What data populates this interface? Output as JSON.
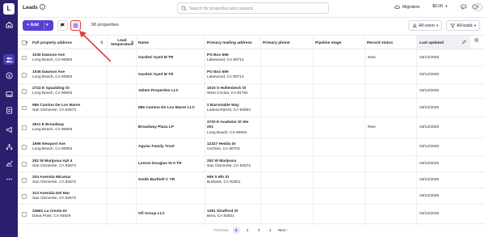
{
  "header": {
    "title": "Leads",
    "info": "i",
    "search_placeholder": "Search for properties and contacts",
    "migration_label": "Migration",
    "balance": "$0.00",
    "avatar_initial": "I"
  },
  "toolbar": {
    "add_label": "+ Add",
    "add_caret": "▾",
    "property_count": "96 properties",
    "all_users_label": "All users",
    "all_leads_label": "All leads"
  },
  "sidebar": {
    "logo": "L",
    "items": [
      "home-icon",
      "leads-icon",
      "dollar-icon",
      "inbox-icon",
      "list-icon",
      "campaign-icon",
      "org-icon",
      "analytics-icon",
      "more-icon"
    ]
  },
  "table": {
    "columns": [
      {
        "label": "Full property address"
      },
      {
        "label": "Lead temperature"
      },
      {
        "label": "Name"
      },
      {
        "label": "Primary mailing address"
      },
      {
        "label": "Primary phone"
      },
      {
        "label": "Pipeline stage"
      },
      {
        "label": "Record status"
      },
      {
        "label": "Last updated"
      }
    ],
    "rows": [
      {
        "addr1": "1040 Dawson Ave",
        "addr2": "Long Beach, CA 90804",
        "name": "Gardezi Syed M TR",
        "mail1": "PO Box 669",
        "mail2": "Lakewood, CA 90714",
        "mail3": "",
        "status": "New",
        "updated": "03/12/2025"
      },
      {
        "addr1": "1036 Dawson Ave",
        "addr2": "Long Beach, CA 90804",
        "name": "Gardezi Syed M TR",
        "mail1": "PO Box 669",
        "mail2": "Lakewood, CA 90714",
        "mail3": "",
        "status": "",
        "updated": "03/12/2025"
      },
      {
        "addr1": "2722 E Spaulding St",
        "addr2": "Long Beach, CA 90804",
        "name": "Aklem Properties LLC",
        "mail1": "1015 S Hollenbeck St",
        "mail2": "West Covina, CA 91791",
        "mail3": "",
        "status": "",
        "updated": "03/12/2025"
      },
      {
        "addr1": "686 Camino De Los Mares",
        "addr2": "San Clemente, CA 92673",
        "name": "686 Camino De Los Mares LLC",
        "mail1": "2 Barnstable Way",
        "mail2": "Ladera Ranch, CA 92694",
        "mail3": "",
        "status": "",
        "updated": "03/12/2025"
      },
      {
        "addr1": "2611 E Broadway",
        "addr2": "Long Beach, CA 90803",
        "name": "Broadway Plaza LP",
        "mail1": "3720 E Anaheim St Ste",
        "mail2": "201",
        "mail3": "Long Beach, CA 90804",
        "status": "New",
        "updated": "03/12/2025"
      },
      {
        "addr1": "1696 Newport Ave",
        "addr2": "Long Beach, CA 90804",
        "name": "Aguiar Family Trust",
        "mail1": "12327 Hedda Dr",
        "mail2": "Cerritos, CA 90703",
        "mail3": "",
        "status": "",
        "updated": "03/12/2025"
      },
      {
        "addr1": "252 W Mariposa Apt 4",
        "addr2": "San Clemente, CA 92672",
        "name": "Lemon Douglas W II TR",
        "mail1": "252 W Mariposa",
        "mail2": "San Clemente, CA 92672",
        "mail3": "",
        "status": "",
        "updated": "03/12/2025"
      },
      {
        "addr1": "204 Avenida Miramar",
        "addr2": "San Clemente, CA 92672",
        "name": "Smith Barthell C TR",
        "mail1": "909 S 6th St",
        "mail2": "Burbank, CA 91501",
        "mail3": "",
        "status": "",
        "updated": "03/12/2025"
      },
      {
        "addr1": "313 Avenida Del Mar",
        "addr2": "San Clemente, CA 92672",
        "name": "",
        "mail1": "",
        "mail2": "",
        "mail3": "",
        "status": "",
        "updated": "03/12/2025"
      },
      {
        "addr1": "24661 La Cresta Dr",
        "addr2": "Dana Point, CA 92629",
        "name": "Ofi Group LLC",
        "mail1": "1391 Stratford St",
        "mail2": "Brea, CA 92821",
        "mail3": "",
        "status": "",
        "updated": "03/12/2025"
      }
    ]
  },
  "pagination": {
    "previous": "‹ Previous",
    "pages": [
      "1",
      "2",
      "3",
      "4"
    ],
    "next": "Next ›"
  },
  "colors": {
    "sidebar": "#2a1f6e",
    "accent": "#5b3fd6",
    "annotation": "#e23b3b"
  }
}
